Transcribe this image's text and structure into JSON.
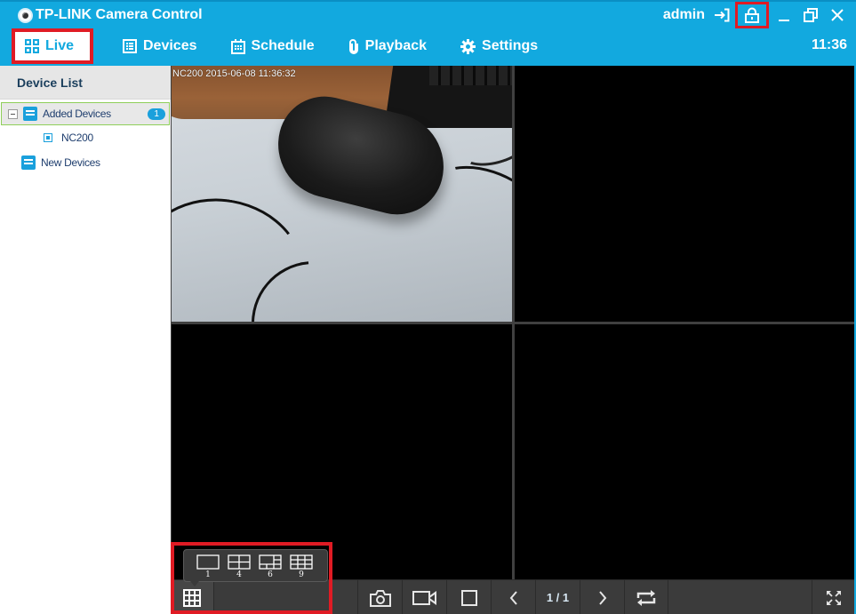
{
  "app": {
    "title": "TP-LINK Camera Control",
    "user": "admin",
    "clock": "11:36",
    "accent_color": "#12a9df",
    "highlight_color": "#e01b24"
  },
  "window_controls": [
    {
      "name": "logout",
      "icon": "logout-icon"
    },
    {
      "name": "lock",
      "icon": "lock-icon",
      "highlighted": true
    },
    {
      "name": "minimize",
      "icon": "minimize-icon"
    },
    {
      "name": "restore",
      "icon": "restore-icon"
    },
    {
      "name": "close",
      "icon": "close-icon"
    }
  ],
  "nav": {
    "items": [
      {
        "label": "Live",
        "icon": "grid-icon",
        "active": true
      },
      {
        "label": "Devices",
        "icon": "list-icon",
        "active": false
      },
      {
        "label": "Schedule",
        "icon": "calendar-icon",
        "active": false
      },
      {
        "label": "Playback",
        "icon": "paperclip-icon",
        "active": false
      },
      {
        "label": "Settings",
        "icon": "gear-icon",
        "active": false
      }
    ]
  },
  "sidebar": {
    "header": "Device List",
    "tree": [
      {
        "label": "Added Devices",
        "count": "1",
        "expanded": true,
        "selected": true,
        "children": [
          {
            "label": "NC200"
          }
        ]
      },
      {
        "label": "New Devices"
      }
    ]
  },
  "video": {
    "panes": [
      {
        "osd": "NC200 2015-06-08 11:36:32",
        "active": true
      },
      {
        "osd": ""
      },
      {
        "osd": ""
      },
      {
        "osd": ""
      }
    ]
  },
  "controls": {
    "layout_options": [
      "1",
      "4",
      "6",
      "9"
    ],
    "buttons": [
      "layout-grid",
      "snapshot",
      "record",
      "stop",
      "previous-page",
      "next-page",
      "cycle",
      "fullscreen"
    ],
    "page_indicator": "1 / 1"
  }
}
